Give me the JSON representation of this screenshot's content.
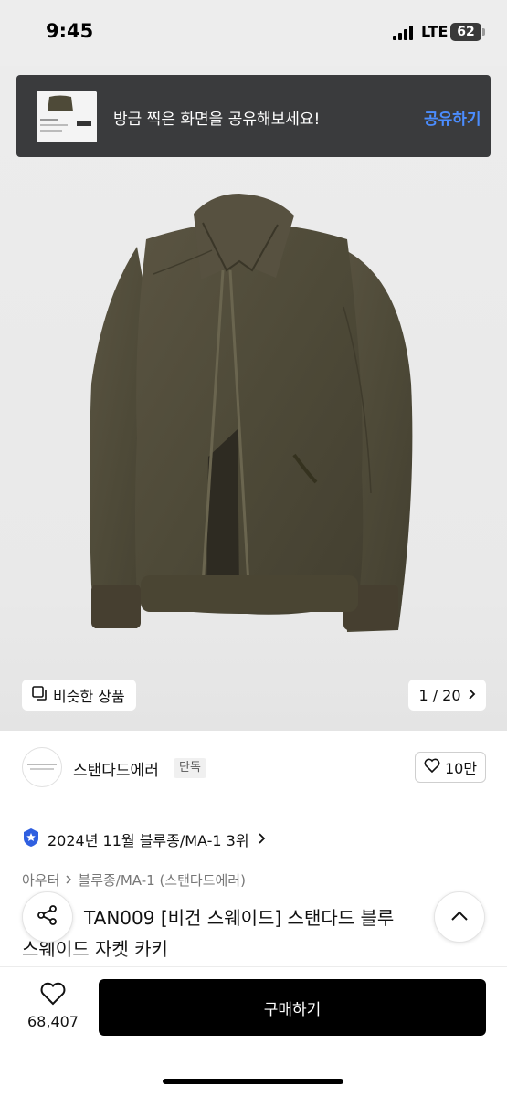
{
  "status_bar": {
    "time": "9:45",
    "network": "LTE",
    "battery": "62"
  },
  "share_toast": {
    "message": "방금 찍은 화면을 공유해보세요!",
    "action_label": "공유하기"
  },
  "gallery": {
    "similar_label": "비슷한 상품",
    "page_indicator": "1 / 20"
  },
  "brand": {
    "name": "스탠다드에러",
    "badge": "단독",
    "likes": "10만"
  },
  "ranking": {
    "text": "2024년 11월 블루종/MA-1 3위"
  },
  "breadcrumb": {
    "category": "아우터",
    "subcategory": "블루종/MA-1 (스탠다드에러)"
  },
  "product": {
    "title_line1": "TAN009 [비건 스웨이드] 스탠다드 블루",
    "title_line2": "스웨이드 자켓 카키"
  },
  "bottom_bar": {
    "wish_count": "68,407",
    "buy_label": "구매하기"
  },
  "colors": {
    "jacket": "#4e4a38",
    "toast_background": "#3a3b3d",
    "toast_action": "#4b8dff",
    "buy_button": "#000000",
    "rank_badge": "#2f5fe0"
  }
}
